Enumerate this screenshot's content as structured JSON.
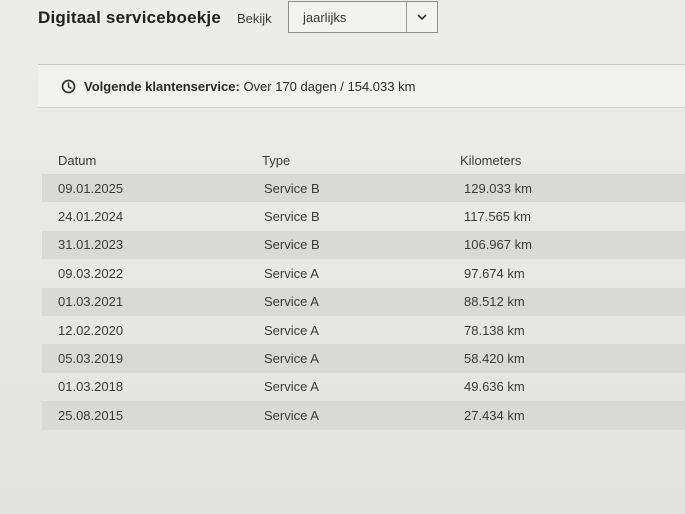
{
  "header": {
    "title": "Digitaal serviceboekje",
    "view_label": "Bekijk",
    "period_select": {
      "selected": "jaarlijks",
      "icon": "chevron-down-icon"
    }
  },
  "next_service": {
    "icon": "clock-icon",
    "label": "Volgende klantenservice:",
    "value": " Over 170 dagen / 154.033 km"
  },
  "table": {
    "columns": {
      "date": "Datum",
      "type": "Type",
      "km": "Kilometers"
    },
    "rows": [
      {
        "date": "09.01.2025",
        "type": "Service B",
        "km": "129.033 km"
      },
      {
        "date": "24.01.2024",
        "type": "Service B",
        "km": "117.565 km"
      },
      {
        "date": "31.01.2023",
        "type": "Service B",
        "km": "106.967 km"
      },
      {
        "date": "09.03.2022",
        "type": "Service A",
        "km": "97.674 km"
      },
      {
        "date": "01.03.2021",
        "type": "Service A",
        "km": "88.512 km"
      },
      {
        "date": "12.02.2020",
        "type": "Service A",
        "km": "78.138 km"
      },
      {
        "date": "05.03.2019",
        "type": "Service A",
        "km": "58.420 km"
      },
      {
        "date": "01.03.2018",
        "type": "Service A",
        "km": "49.636 km"
      },
      {
        "date": "25.08.2015",
        "type": "Service A",
        "km": "27.434 km"
      }
    ]
  }
}
